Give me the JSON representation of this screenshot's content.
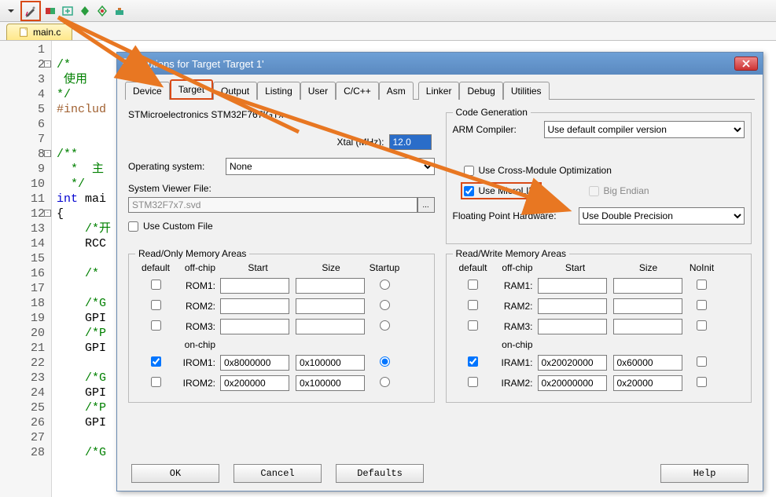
{
  "filetab": {
    "name": "main.c"
  },
  "editor": {
    "lines": [
      {
        "n": "1",
        "cls": "",
        "txt": ""
      },
      {
        "n": "2",
        "cls": "c-comment",
        "txt": "/*",
        "fold": "-"
      },
      {
        "n": "3",
        "cls": "c-comment",
        "txt": " 使用"
      },
      {
        "n": "4",
        "cls": "c-comment",
        "txt": "*/"
      },
      {
        "n": "5",
        "cls": "c-pp",
        "txt": "#includ"
      },
      {
        "n": "6",
        "cls": "",
        "txt": ""
      },
      {
        "n": "7",
        "cls": "",
        "txt": ""
      },
      {
        "n": "8",
        "cls": "c-comment",
        "txt": "/**",
        "fold": "-"
      },
      {
        "n": "9",
        "cls": "c-comment",
        "txt": "  *  主"
      },
      {
        "n": "10",
        "cls": "c-comment",
        "txt": "  */"
      },
      {
        "n": "11",
        "cls": "",
        "txt": "int mai",
        "kw": "int"
      },
      {
        "n": "12",
        "cls": "",
        "txt": "{",
        "fold": "-"
      },
      {
        "n": "13",
        "cls": "c-comment",
        "txt": "    /*开"
      },
      {
        "n": "14",
        "cls": "c-txt",
        "txt": "    RCC"
      },
      {
        "n": "15",
        "cls": "",
        "txt": ""
      },
      {
        "n": "16",
        "cls": "c-comment",
        "txt": "    /*"
      },
      {
        "n": "17",
        "cls": "",
        "txt": ""
      },
      {
        "n": "18",
        "cls": "c-comment",
        "txt": "    /*G"
      },
      {
        "n": "19",
        "cls": "c-txt",
        "txt": "    GPI"
      },
      {
        "n": "20",
        "cls": "c-comment",
        "txt": "    /*P"
      },
      {
        "n": "21",
        "cls": "c-txt",
        "txt": "    GPI"
      },
      {
        "n": "22",
        "cls": "",
        "txt": ""
      },
      {
        "n": "23",
        "cls": "c-comment",
        "txt": "    /*G"
      },
      {
        "n": "24",
        "cls": "c-txt",
        "txt": "    GPI"
      },
      {
        "n": "25",
        "cls": "c-comment",
        "txt": "    /*P"
      },
      {
        "n": "26",
        "cls": "c-txt",
        "txt": "    GPI"
      },
      {
        "n": "27",
        "cls": "",
        "txt": ""
      },
      {
        "n": "28",
        "cls": "c-comment",
        "txt": "    /*G"
      }
    ]
  },
  "dialog": {
    "title": "Options for Target 'Target 1'",
    "tabs": [
      "Device",
      "Target",
      "Output",
      "Listing",
      "User",
      "C/C++",
      "Asm",
      "Linker",
      "Debug",
      "Utilities"
    ],
    "chip": "STMicroelectronics STM32F767IGTx",
    "xtal_label": "Xtal (MHz):",
    "xtal_value": "12.0",
    "os_label": "Operating system:",
    "os_value": "None",
    "svf_label": "System Viewer File:",
    "svf_value": "STM32F7x7.svd",
    "use_custom_file": "Use Custom File",
    "codegen": {
      "legend": "Code Generation",
      "arm_compiler_label": "ARM Compiler:",
      "arm_compiler_value": "Use default compiler version",
      "cross_opt": "Use Cross-Module Optimization",
      "microlib": "Use MicroLIB",
      "big_endian": "Big Endian",
      "fp_label": "Floating Point Hardware:",
      "fp_value": "Use Double Precision"
    },
    "romem": {
      "legend": "Read/Only Memory Areas",
      "hdr": {
        "default": "default",
        "chip": "off-chip",
        "start": "Start",
        "size": "Size",
        "startup": "Startup"
      },
      "onchip": "on-chip",
      "rows": [
        {
          "lbl": "ROM1:",
          "def": false,
          "start": "",
          "size": "",
          "sel": false
        },
        {
          "lbl": "ROM2:",
          "def": false,
          "start": "",
          "size": "",
          "sel": false
        },
        {
          "lbl": "ROM3:",
          "def": false,
          "start": "",
          "size": "",
          "sel": false
        },
        {
          "lbl": "IROM1:",
          "def": true,
          "start": "0x8000000",
          "size": "0x100000",
          "sel": true
        },
        {
          "lbl": "IROM2:",
          "def": false,
          "start": "0x200000",
          "size": "0x100000",
          "sel": false
        }
      ]
    },
    "rwmem": {
      "legend": "Read/Write Memory Areas",
      "hdr": {
        "default": "default",
        "chip": "off-chip",
        "start": "Start",
        "size": "Size",
        "noinit": "NoInit"
      },
      "onchip": "on-chip",
      "rows": [
        {
          "lbl": "RAM1:",
          "def": false,
          "start": "",
          "size": "",
          "ni": false
        },
        {
          "lbl": "RAM2:",
          "def": false,
          "start": "",
          "size": "",
          "ni": false
        },
        {
          "lbl": "RAM3:",
          "def": false,
          "start": "",
          "size": "",
          "ni": false
        },
        {
          "lbl": "IRAM1:",
          "def": true,
          "start": "0x20020000",
          "size": "0x60000",
          "ni": false
        },
        {
          "lbl": "IRAM2:",
          "def": false,
          "start": "0x20000000",
          "size": "0x20000",
          "ni": false
        }
      ]
    },
    "buttons": {
      "ok": "OK",
      "cancel": "Cancel",
      "defaults": "Defaults",
      "help": "Help"
    }
  }
}
